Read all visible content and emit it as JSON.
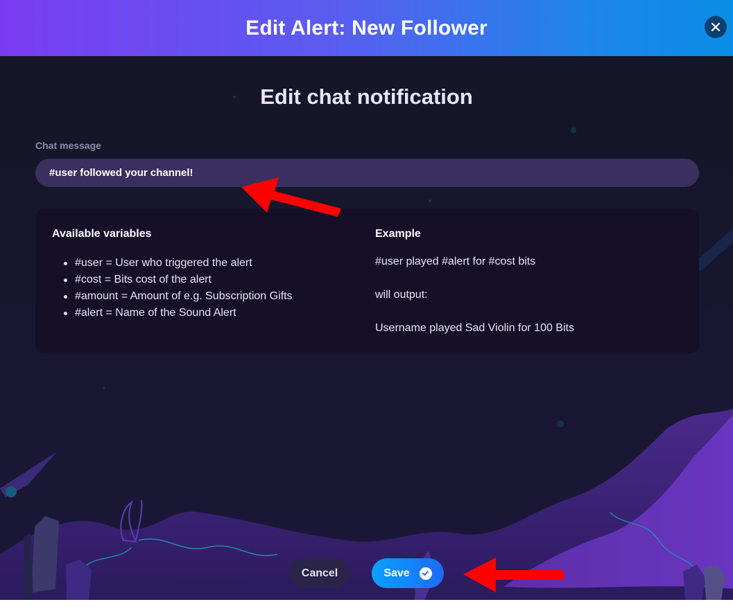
{
  "header": {
    "title": "Edit Alert: New Follower"
  },
  "section": {
    "title": "Edit chat notification"
  },
  "chat_message": {
    "label": "Chat message",
    "value": "#user followed your channel!"
  },
  "variables": {
    "heading": "Available variables",
    "items": [
      "#user = User who triggered the alert",
      "#cost = Bits cost of the alert",
      "#amount = Amount of e.g. Subscription Gifts",
      "#alert = Name of the Sound Alert"
    ]
  },
  "example": {
    "heading": "Example",
    "input": "#user played #alert for #cost bits",
    "middle": "will output:",
    "output": "Username played Sad Violin for 100 Bits"
  },
  "buttons": {
    "cancel": "Cancel",
    "save": "Save"
  },
  "icons": {
    "close": "close-icon",
    "save": "check-circle-icon"
  },
  "colors": {
    "header_gradient_start": "#7b3cf0",
    "header_gradient_end": "#0a8ee6",
    "background": "#15152a",
    "save_button": "#0aa1ff",
    "annotation_arrow": "#ff0000"
  }
}
